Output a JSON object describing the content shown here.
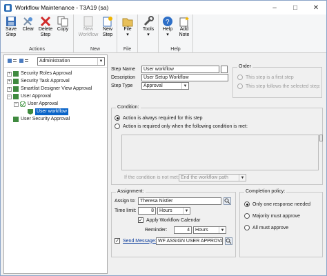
{
  "window": {
    "title": "Workflow Maintenance  -  T3A19 (sa)",
    "controls": [
      "minimize-icon",
      "maximize-icon",
      "close-icon"
    ]
  },
  "ribbon": {
    "groups": [
      {
        "label": "Actions",
        "buttons": [
          {
            "label": "Save\nStep",
            "icon": "save-icon",
            "enabled": true
          },
          {
            "label": "Clear",
            "icon": "clear-icon",
            "enabled": true
          },
          {
            "label": "Delete\nStep",
            "icon": "delete-icon",
            "enabled": true
          },
          {
            "label": "Copy",
            "icon": "copy-icon",
            "enabled": true
          }
        ]
      },
      {
        "label": "New",
        "buttons": [
          {
            "label": "New\nWorkflow",
            "icon": "new-workflow-icon",
            "enabled": false
          },
          {
            "label": "New\nStep",
            "icon": "new-step-icon",
            "enabled": true
          }
        ]
      },
      {
        "label": "File",
        "buttons": [
          {
            "label": "File",
            "icon": "file-icon",
            "enabled": true
          }
        ]
      },
      {
        "label": "",
        "buttons": [
          {
            "label": "Tools",
            "icon": "tools-icon",
            "enabled": true
          }
        ]
      },
      {
        "label": "Help",
        "buttons": [
          {
            "label": "Help",
            "icon": "help-icon",
            "enabled": true
          },
          {
            "label": "Add\nNote",
            "icon": "add-note-icon",
            "enabled": true
          }
        ]
      }
    ]
  },
  "tree": {
    "filter_value": "Administration",
    "items": [
      {
        "label": "Security Roles Approval",
        "expander": "+",
        "icon": "workflow-icon"
      },
      {
        "label": "Security Task Approval",
        "expander": "+",
        "icon": "workflow-icon"
      },
      {
        "label": "Smartlist Designer View Approval",
        "expander": "+",
        "icon": "workflow-icon"
      },
      {
        "label": "User Approval",
        "expander": "−",
        "icon": "workflow-icon"
      },
      {
        "label": "User Approval",
        "expander": "−",
        "icon": "checkmark-icon"
      },
      {
        "label": "User workflow",
        "expander": "",
        "icon": "step-icon",
        "selected": true
      },
      {
        "label": "User Security Approval",
        "expander": "",
        "icon": "workflow-icon"
      }
    ]
  },
  "step": {
    "name_label": "Step Name",
    "name_value": "User workflow",
    "description_label": "Description",
    "description_value": "User Setup Workflow",
    "type_label": "Step Type",
    "type_value": "Approval"
  },
  "order": {
    "legend": "Order",
    "option1": "This step is a first step",
    "option2": "This step follows the selected step:"
  },
  "condition": {
    "legend": "Condition:",
    "option1": "Action is always required for this step",
    "option2": "Action is required only when the following condition is met:",
    "not_met_label": "If the condition is not met:",
    "not_met_value": "End the workflow path"
  },
  "assignment": {
    "legend": "Assignment:",
    "assign_label": "Assign to:",
    "assign_value": "Theresa Nistler",
    "time_label": "Time limit:",
    "time_value": "8",
    "time_unit": "Hours",
    "calendar_label": "Apply Workflow Calendar",
    "reminder_label": "Reminder:",
    "reminder_value": "4",
    "reminder_unit": "Hours",
    "send_label": "Send Message:",
    "send_value": "WF ASSIGN USER APPROVAL*"
  },
  "completion": {
    "legend": "Completion policy:",
    "option1": "Only one response needed",
    "option2": "Majority must approve",
    "option3": "All must approve"
  }
}
